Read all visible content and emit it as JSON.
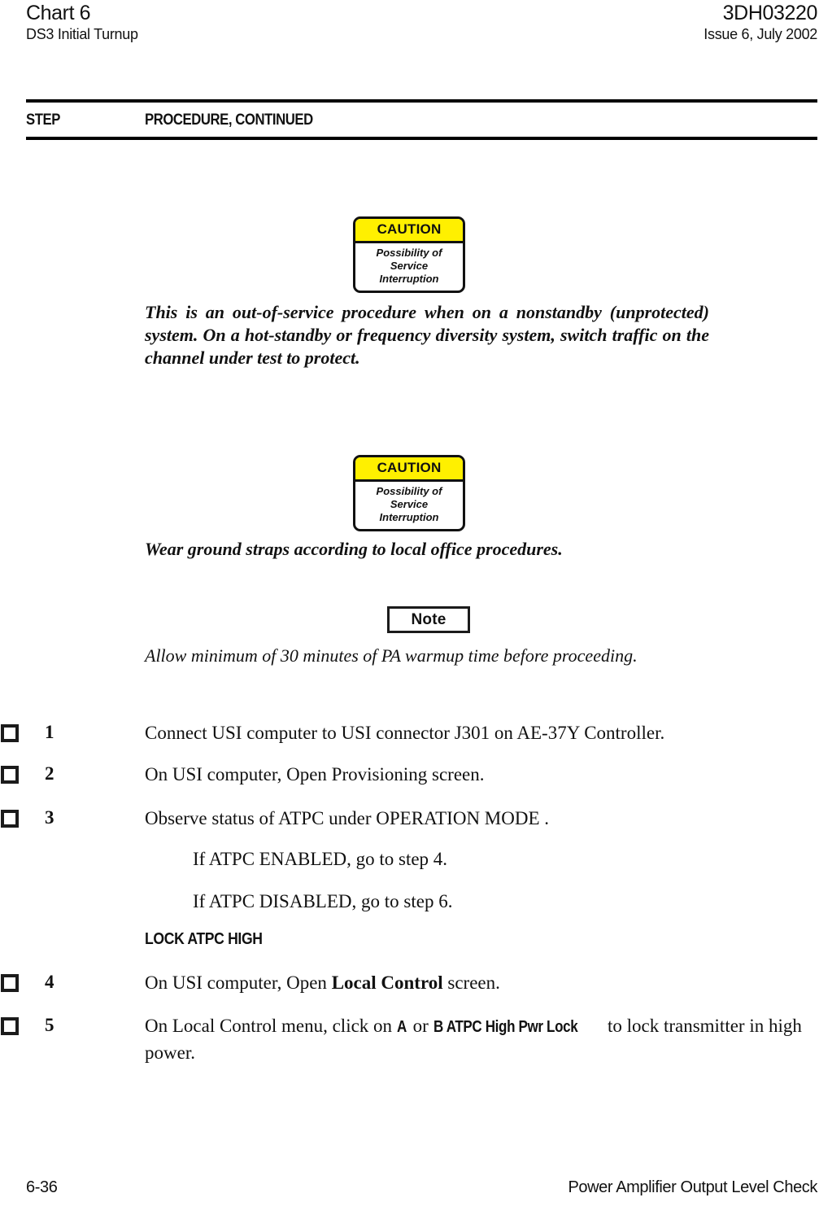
{
  "header": {
    "chart_title": "Chart 6",
    "chart_subtitle": "DS3 Initial Turnup",
    "doc_number": "3DH03220",
    "issue": "Issue 6, July 2002"
  },
  "column_headings": {
    "step": "STEP",
    "procedure": "PROCEDURE, CONTINUED"
  },
  "caution_1": {
    "title": "CAUTION",
    "line1": "Possibility of",
    "line2": "Service",
    "line3": "Interruption",
    "header_color": "#FFF000",
    "text": "This is an out-of-service procedure when on a nonstandby (unprotected) system. On a hot-standby or frequency diversity system, switch traffic on the channel under test to protect."
  },
  "caution_2": {
    "title": "CAUTION",
    "line1": "Possibility of",
    "line2": "Service",
    "line3": "Interruption",
    "header_color": "#FFF000",
    "text": "Wear ground straps according to local office procedures."
  },
  "note": {
    "title": "Note",
    "text": "Allow minimum of 30 minutes of PA warmup time before proceeding."
  },
  "steps": [
    {
      "number": "1",
      "text": "Connect USI computer to USI connector J301 on AE-37Y Controller."
    },
    {
      "number": "2",
      "text": "On USI computer, Open Provisioning screen."
    },
    {
      "number": "3",
      "text": "Observe status of ATPC under OPERATION MODE ."
    },
    {
      "number": "4",
      "text_before": "On USI computer, Open ",
      "bold": "Local Control",
      "text_after": " screen."
    },
    {
      "number": "5",
      "text_before": "On Local Control menu, click on ",
      "bold_a": "A",
      "text_mid": " or ",
      "bold_b": "B ATPC High Pwr Lock",
      "text_after": " to lock transmitter in high power."
    }
  ],
  "sub_lines": {
    "enabled": "If ATPC ENABLED, go to step 4.",
    "disabled": "If ATPC DISABLED, go to step 6."
  },
  "section_heading": "LOCK ATPC HIGH",
  "footer": {
    "page_number": "6-36",
    "section_title": "Power Amplifier Output Level Check"
  }
}
